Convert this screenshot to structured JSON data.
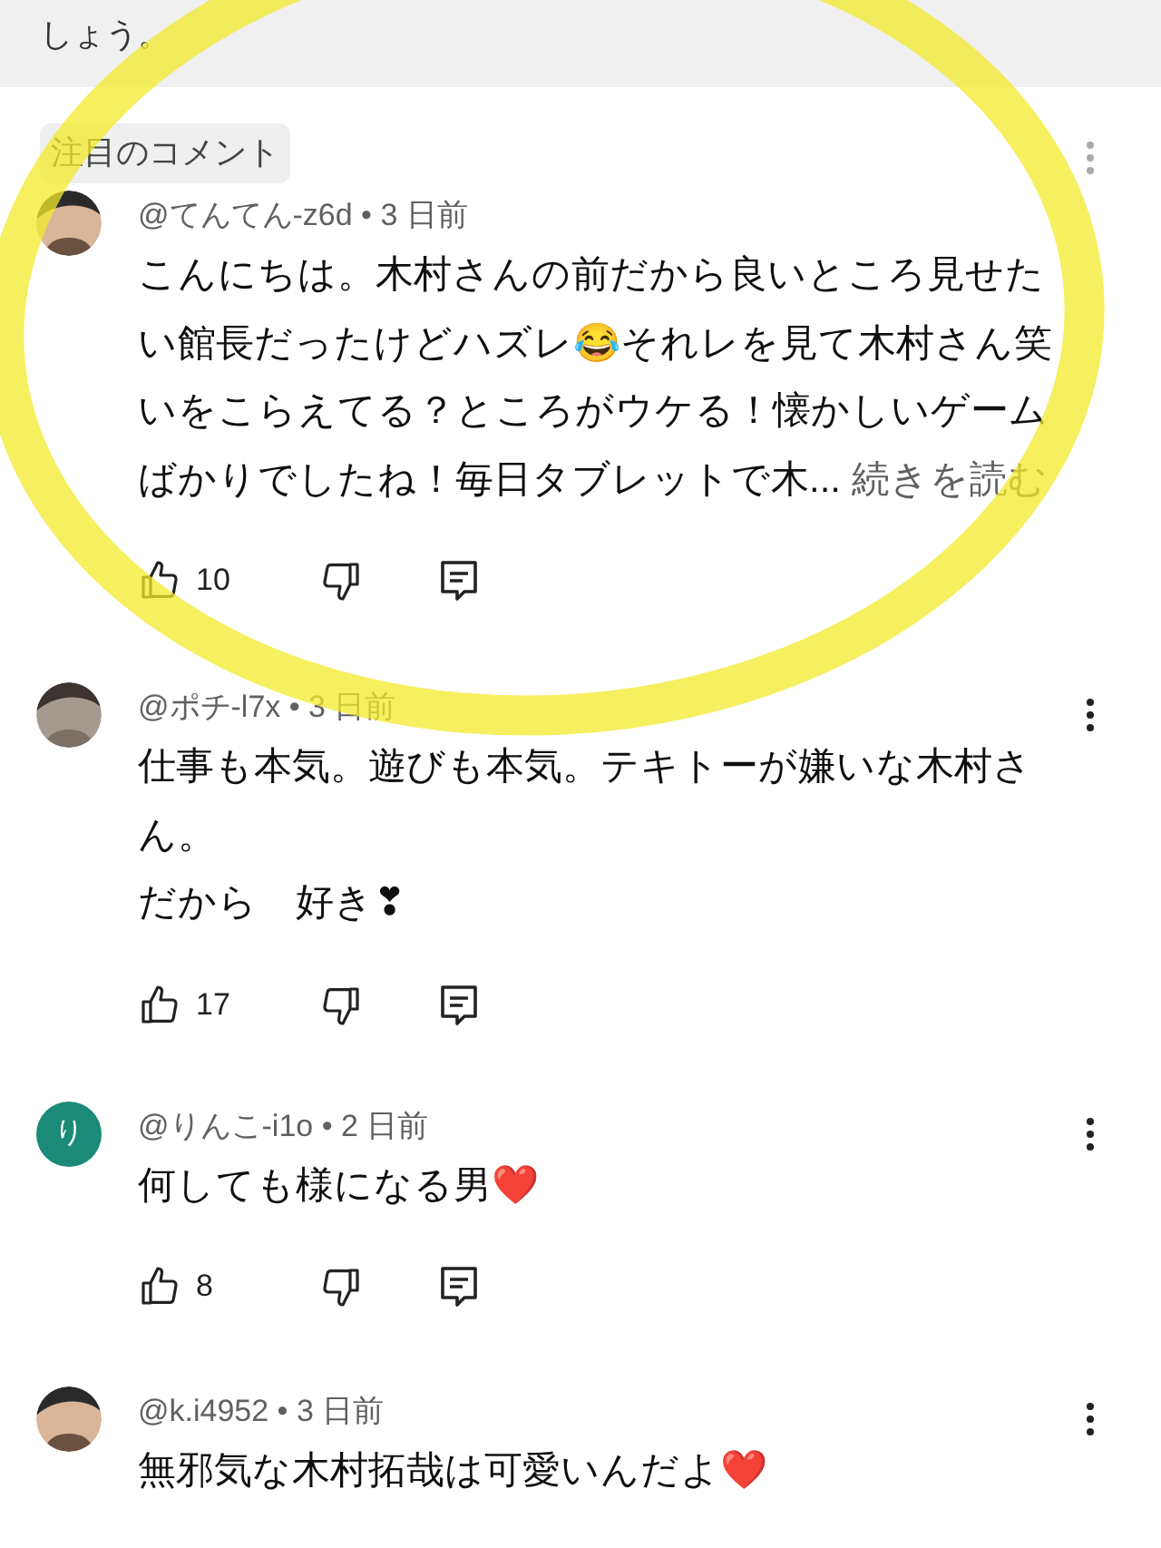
{
  "notice": {
    "text": "しょう。"
  },
  "section_label": "注目のコメント",
  "comments": [
    {
      "meta": "@てんてん-z6d • 3 日前",
      "text": "こんにちは。木村さんの前だから良いところ見せたい館長だったけどハズレ😂それレを見て木村さん笑いをこらえてる？ところがウケる！懐かしいゲームばかりでしたね！毎日タブレットで木...",
      "read_more": "続きを読む",
      "likes": "10"
    },
    {
      "meta": "@ポチ-l7x • 3 日前",
      "text": "仕事も本気。遊びも本気。テキトーが嫌いな木村さん。",
      "text_2": "だから　好き❣",
      "likes": "17"
    },
    {
      "meta": "@りんこ-i1o • 2 日前",
      "avatar": {
        "kind": "letter",
        "letter": "り",
        "color": "#1b8a78"
      },
      "text": "何しても様になる男❤️",
      "likes": "8"
    },
    {
      "meta": "@k.i4952 • 3 日前",
      "text": "無邪気な木村拓哉は可愛いんだよ❤️"
    }
  ]
}
